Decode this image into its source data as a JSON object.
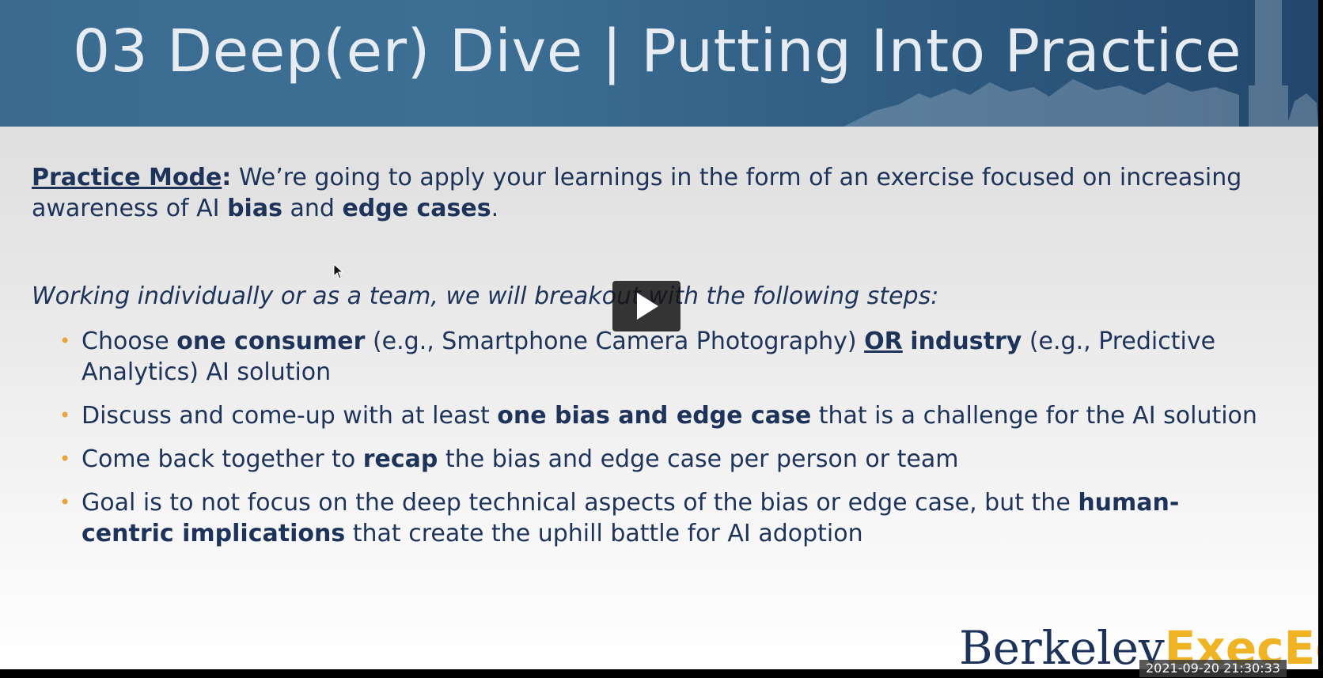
{
  "slide": {
    "title": "03 Deep(er) Dive | Putting Into Practice",
    "intro": {
      "lead": "Practice Mode",
      "lead_colon": ":",
      "text_1": " We’re going to apply your learnings in the form of an exercise focused on increasing awareness of AI ",
      "bold_1": "bias",
      "text_2": " and ",
      "bold_2": "edge cases",
      "text_3": "."
    },
    "steps_intro": "Working individually or as a team, we will breakout with the following steps:",
    "bullets": [
      {
        "t1": "Choose ",
        "b1": "one consumer",
        "t2": " (e.g., Smartphone Camera Photography) ",
        "u1": "OR",
        "t3": " ",
        "b2": "industry",
        "t4": " (e.g., Predictive Analytics) AI solution"
      },
      {
        "t1": "Discuss and come-up with at least ",
        "b1": "one bias and edge case",
        "t2": " that is a challenge for the AI solution"
      },
      {
        "t1": "Come back together to ",
        "b1": "recap",
        "t2": " the bias and edge case per person or team"
      },
      {
        "t1": "Goal is to not focus on the deep technical aspects of the bias or edge case, but the ",
        "b1": "human-centric implications",
        "t2": " that create the uphill battle for AI adoption"
      }
    ],
    "bullet_glyph": "•",
    "logo": {
      "part1": "Berkeley",
      "part2": "ExecEd"
    }
  },
  "player": {
    "play_icon": "play-icon",
    "timestamp": "2021-09-20 21:30:33"
  },
  "colors": {
    "header_blue": "#3d6f95",
    "text_navy": "#1e3359",
    "bullet_orange": "#e8a33d",
    "logo_gold": "#f0b323"
  }
}
